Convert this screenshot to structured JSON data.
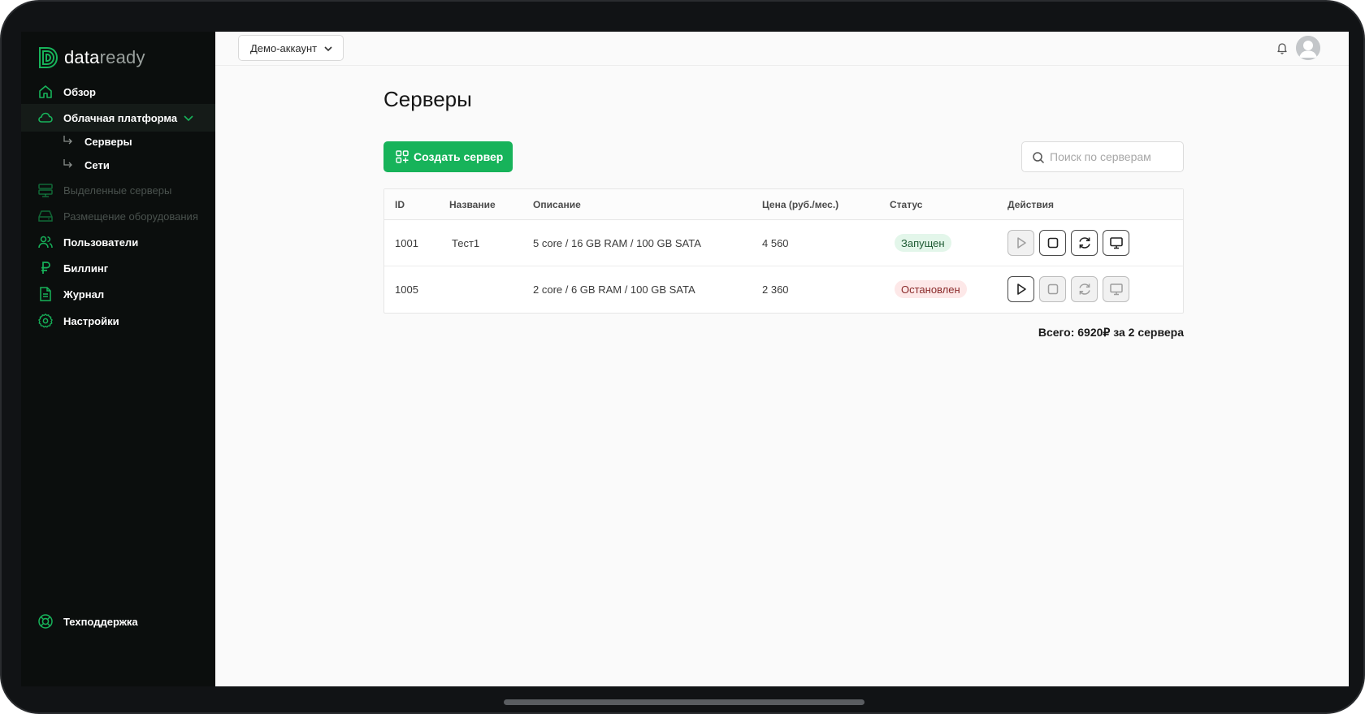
{
  "brand": {
    "name_part1": "data",
    "name_part2": "ready",
    "accent": "#17b35a"
  },
  "sidebar": {
    "items": [
      {
        "label": "Обзор",
        "icon": "home-icon"
      },
      {
        "label": "Облачная платформа",
        "icon": "cloud-icon",
        "expanded": true
      },
      {
        "label": "Выделенные серверы",
        "icon": "server-stack-icon",
        "disabled": true
      },
      {
        "label": "Размещение оборудования",
        "icon": "hard-drive-icon",
        "disabled": true
      },
      {
        "label": "Пользователи",
        "icon": "users-icon"
      },
      {
        "label": "Биллинг",
        "icon": "ruble-icon"
      },
      {
        "label": "Журнал",
        "icon": "document-icon"
      },
      {
        "label": "Настройки",
        "icon": "gear-icon"
      }
    ],
    "subitems": [
      {
        "label": "Серверы"
      },
      {
        "label": "Сети"
      }
    ],
    "support": {
      "label": "Техподдержка",
      "icon": "lifebuoy-icon"
    }
  },
  "header": {
    "account": "Демо-аккаунт"
  },
  "main": {
    "title": "Серверы",
    "create_button": "Создать сервер",
    "search_placeholder": "Поиск по серверам",
    "table": {
      "headers": [
        "ID",
        "Название",
        "Описание",
        "Цена (руб./мес.)",
        "Статус",
        "Действия"
      ],
      "rows": [
        {
          "id": "1001",
          "name": "Тест1",
          "description": "5 core / 16 GB RAM / 100 GB SATA",
          "price": "4 560",
          "status": "Запущен",
          "status_color": "green"
        },
        {
          "id": "1005",
          "name": "",
          "description": "2 core / 6 GB RAM / 100 GB SATA",
          "price": "2 360",
          "status": "Остановлен",
          "status_color": "red"
        }
      ]
    },
    "total": "Всего: 6920₽ за 2 сервера"
  }
}
